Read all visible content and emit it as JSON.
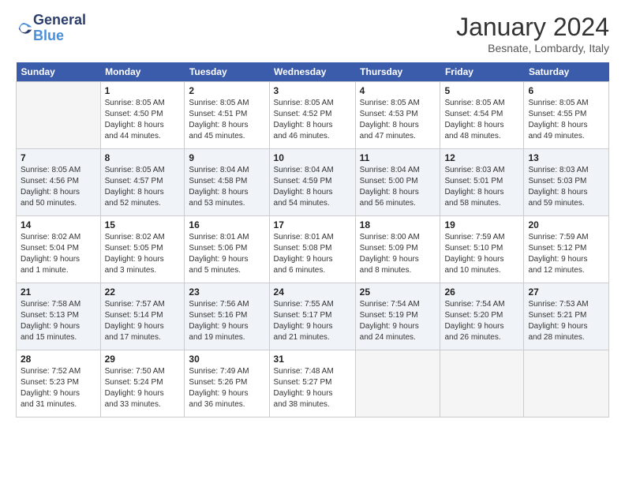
{
  "logo": {
    "line1": "General",
    "line2": "Blue"
  },
  "title": "January 2024",
  "location": "Besnate, Lombardy, Italy",
  "days_of_week": [
    "Sunday",
    "Monday",
    "Tuesday",
    "Wednesday",
    "Thursday",
    "Friday",
    "Saturday"
  ],
  "weeks": [
    [
      {
        "day": "",
        "info": ""
      },
      {
        "day": "1",
        "info": "Sunrise: 8:05 AM\nSunset: 4:50 PM\nDaylight: 8 hours\nand 44 minutes."
      },
      {
        "day": "2",
        "info": "Sunrise: 8:05 AM\nSunset: 4:51 PM\nDaylight: 8 hours\nand 45 minutes."
      },
      {
        "day": "3",
        "info": "Sunrise: 8:05 AM\nSunset: 4:52 PM\nDaylight: 8 hours\nand 46 minutes."
      },
      {
        "day": "4",
        "info": "Sunrise: 8:05 AM\nSunset: 4:53 PM\nDaylight: 8 hours\nand 47 minutes."
      },
      {
        "day": "5",
        "info": "Sunrise: 8:05 AM\nSunset: 4:54 PM\nDaylight: 8 hours\nand 48 minutes."
      },
      {
        "day": "6",
        "info": "Sunrise: 8:05 AM\nSunset: 4:55 PM\nDaylight: 8 hours\nand 49 minutes."
      }
    ],
    [
      {
        "day": "7",
        "info": "Sunrise: 8:05 AM\nSunset: 4:56 PM\nDaylight: 8 hours\nand 50 minutes."
      },
      {
        "day": "8",
        "info": "Sunrise: 8:05 AM\nSunset: 4:57 PM\nDaylight: 8 hours\nand 52 minutes."
      },
      {
        "day": "9",
        "info": "Sunrise: 8:04 AM\nSunset: 4:58 PM\nDaylight: 8 hours\nand 53 minutes."
      },
      {
        "day": "10",
        "info": "Sunrise: 8:04 AM\nSunset: 4:59 PM\nDaylight: 8 hours\nand 54 minutes."
      },
      {
        "day": "11",
        "info": "Sunrise: 8:04 AM\nSunset: 5:00 PM\nDaylight: 8 hours\nand 56 minutes."
      },
      {
        "day": "12",
        "info": "Sunrise: 8:03 AM\nSunset: 5:01 PM\nDaylight: 8 hours\nand 58 minutes."
      },
      {
        "day": "13",
        "info": "Sunrise: 8:03 AM\nSunset: 5:03 PM\nDaylight: 8 hours\nand 59 minutes."
      }
    ],
    [
      {
        "day": "14",
        "info": "Sunrise: 8:02 AM\nSunset: 5:04 PM\nDaylight: 9 hours\nand 1 minute."
      },
      {
        "day": "15",
        "info": "Sunrise: 8:02 AM\nSunset: 5:05 PM\nDaylight: 9 hours\nand 3 minutes."
      },
      {
        "day": "16",
        "info": "Sunrise: 8:01 AM\nSunset: 5:06 PM\nDaylight: 9 hours\nand 5 minutes."
      },
      {
        "day": "17",
        "info": "Sunrise: 8:01 AM\nSunset: 5:08 PM\nDaylight: 9 hours\nand 6 minutes."
      },
      {
        "day": "18",
        "info": "Sunrise: 8:00 AM\nSunset: 5:09 PM\nDaylight: 9 hours\nand 8 minutes."
      },
      {
        "day": "19",
        "info": "Sunrise: 7:59 AM\nSunset: 5:10 PM\nDaylight: 9 hours\nand 10 minutes."
      },
      {
        "day": "20",
        "info": "Sunrise: 7:59 AM\nSunset: 5:12 PM\nDaylight: 9 hours\nand 12 minutes."
      }
    ],
    [
      {
        "day": "21",
        "info": "Sunrise: 7:58 AM\nSunset: 5:13 PM\nDaylight: 9 hours\nand 15 minutes."
      },
      {
        "day": "22",
        "info": "Sunrise: 7:57 AM\nSunset: 5:14 PM\nDaylight: 9 hours\nand 17 minutes."
      },
      {
        "day": "23",
        "info": "Sunrise: 7:56 AM\nSunset: 5:16 PM\nDaylight: 9 hours\nand 19 minutes."
      },
      {
        "day": "24",
        "info": "Sunrise: 7:55 AM\nSunset: 5:17 PM\nDaylight: 9 hours\nand 21 minutes."
      },
      {
        "day": "25",
        "info": "Sunrise: 7:54 AM\nSunset: 5:19 PM\nDaylight: 9 hours\nand 24 minutes."
      },
      {
        "day": "26",
        "info": "Sunrise: 7:54 AM\nSunset: 5:20 PM\nDaylight: 9 hours\nand 26 minutes."
      },
      {
        "day": "27",
        "info": "Sunrise: 7:53 AM\nSunset: 5:21 PM\nDaylight: 9 hours\nand 28 minutes."
      }
    ],
    [
      {
        "day": "28",
        "info": "Sunrise: 7:52 AM\nSunset: 5:23 PM\nDaylight: 9 hours\nand 31 minutes."
      },
      {
        "day": "29",
        "info": "Sunrise: 7:50 AM\nSunset: 5:24 PM\nDaylight: 9 hours\nand 33 minutes."
      },
      {
        "day": "30",
        "info": "Sunrise: 7:49 AM\nSunset: 5:26 PM\nDaylight: 9 hours\nand 36 minutes."
      },
      {
        "day": "31",
        "info": "Sunrise: 7:48 AM\nSunset: 5:27 PM\nDaylight: 9 hours\nand 38 minutes."
      },
      {
        "day": "",
        "info": ""
      },
      {
        "day": "",
        "info": ""
      },
      {
        "day": "",
        "info": ""
      }
    ]
  ]
}
